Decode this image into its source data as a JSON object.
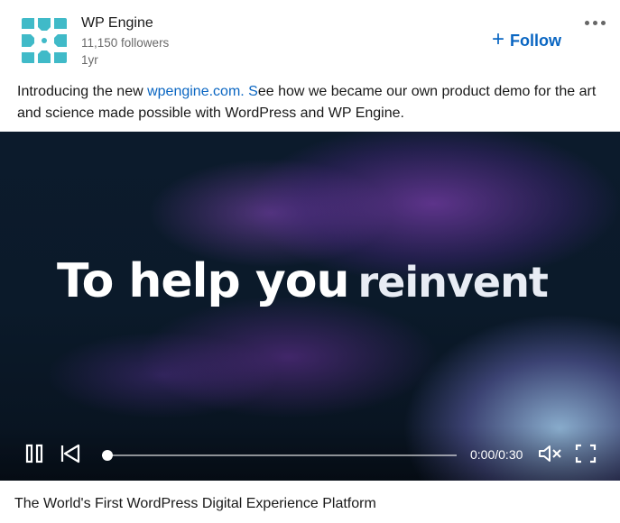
{
  "company": {
    "name": "WP Engine",
    "followers": "11,150 followers",
    "age": "1yr",
    "logo_icon": "wp-engine-logo",
    "brand_color": "#40bac8"
  },
  "actions": {
    "follow_plus": "+",
    "follow_label": "Follow",
    "more_icon": "ellipsis-icon"
  },
  "post": {
    "text_before": "Introducing the new ",
    "link": "wpengine.com. S",
    "text_after": "ee how we became our own product demo for the art and science made possible with WordPress and WP Engine."
  },
  "video": {
    "caption_bold": "To help you",
    "caption_light": "reinvent",
    "time": "0:00/0:30",
    "progress": 0,
    "state": "playing",
    "muted": true
  },
  "video_title": "The World's First WordPress Digital Experience Platform",
  "colors": {
    "link": "#0a66c2",
    "video_bg": "#0b1a2a"
  }
}
